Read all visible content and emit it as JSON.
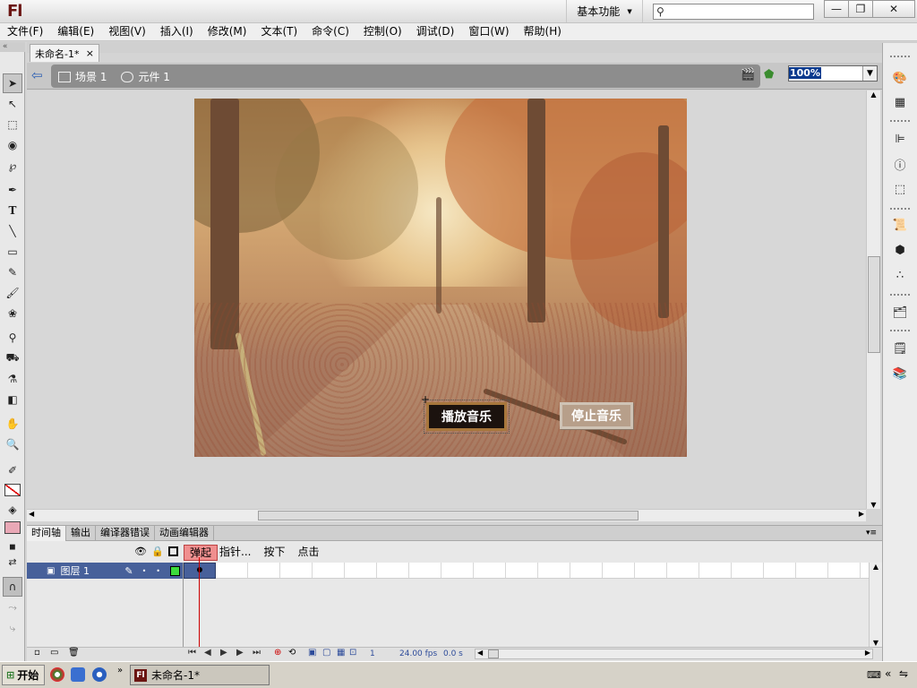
{
  "app": {
    "logo": "Fl"
  },
  "titlebar": {
    "workspace": "基本功能",
    "search_placeholder": "",
    "min": "—",
    "restore": "❐",
    "close": "✕"
  },
  "menu": [
    "文件(F)",
    "编辑(E)",
    "视图(V)",
    "插入(I)",
    "修改(M)",
    "文本(T)",
    "命令(C)",
    "控制(O)",
    "调试(D)",
    "窗口(W)",
    "帮助(H)"
  ],
  "document": {
    "tab": "未命名-1*",
    "close": "×"
  },
  "breadcrumb": {
    "scene": "场景 1",
    "symbol": "元件 1"
  },
  "zoom": {
    "value": "100%"
  },
  "stage": {
    "play_button": "播放音乐",
    "stop_button": "停止音乐"
  },
  "bottom_tabs": [
    "时间轴",
    "输出",
    "编译器错误",
    "动画编辑器"
  ],
  "timeline": {
    "frame_labels": [
      "弹起",
      "指针...",
      "按下",
      "点击"
    ],
    "current_frame_label": "弹起",
    "layer_name": "图层 1",
    "frame": "1",
    "fps": "24.00 fps",
    "time": "0.0 s"
  },
  "taskbar": {
    "start": "开始",
    "item": "未命名-1*"
  },
  "colors": {
    "layer_highlight": "#47609a",
    "frame_label_active": "#f08f8f",
    "logo": "#6b1512"
  }
}
